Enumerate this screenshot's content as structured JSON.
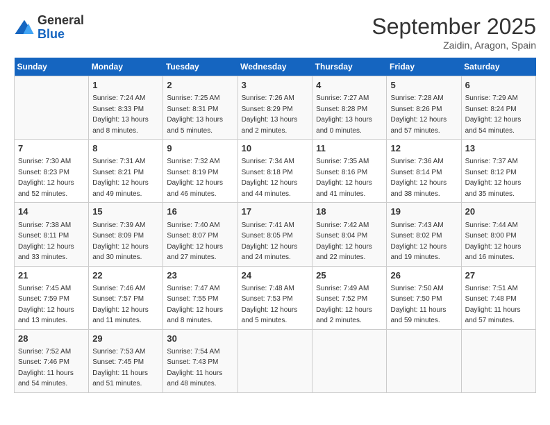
{
  "logo": {
    "general": "General",
    "blue": "Blue"
  },
  "header": {
    "month": "September 2025",
    "location": "Zaidin, Aragon, Spain"
  },
  "weekdays": [
    "Sunday",
    "Monday",
    "Tuesday",
    "Wednesday",
    "Thursday",
    "Friday",
    "Saturday"
  ],
  "weeks": [
    [
      {
        "day": null
      },
      {
        "day": 1,
        "sunrise": "7:24 AM",
        "sunset": "8:33 PM",
        "daylight": "13 hours and 8 minutes."
      },
      {
        "day": 2,
        "sunrise": "7:25 AM",
        "sunset": "8:31 PM",
        "daylight": "13 hours and 5 minutes."
      },
      {
        "day": 3,
        "sunrise": "7:26 AM",
        "sunset": "8:29 PM",
        "daylight": "13 hours and 2 minutes."
      },
      {
        "day": 4,
        "sunrise": "7:27 AM",
        "sunset": "8:28 PM",
        "daylight": "13 hours and 0 minutes."
      },
      {
        "day": 5,
        "sunrise": "7:28 AM",
        "sunset": "8:26 PM",
        "daylight": "12 hours and 57 minutes."
      },
      {
        "day": 6,
        "sunrise": "7:29 AM",
        "sunset": "8:24 PM",
        "daylight": "12 hours and 54 minutes."
      }
    ],
    [
      {
        "day": 7,
        "sunrise": "7:30 AM",
        "sunset": "8:23 PM",
        "daylight": "12 hours and 52 minutes."
      },
      {
        "day": 8,
        "sunrise": "7:31 AM",
        "sunset": "8:21 PM",
        "daylight": "12 hours and 49 minutes."
      },
      {
        "day": 9,
        "sunrise": "7:32 AM",
        "sunset": "8:19 PM",
        "daylight": "12 hours and 46 minutes."
      },
      {
        "day": 10,
        "sunrise": "7:34 AM",
        "sunset": "8:18 PM",
        "daylight": "12 hours and 44 minutes."
      },
      {
        "day": 11,
        "sunrise": "7:35 AM",
        "sunset": "8:16 PM",
        "daylight": "12 hours and 41 minutes."
      },
      {
        "day": 12,
        "sunrise": "7:36 AM",
        "sunset": "8:14 PM",
        "daylight": "12 hours and 38 minutes."
      },
      {
        "day": 13,
        "sunrise": "7:37 AM",
        "sunset": "8:12 PM",
        "daylight": "12 hours and 35 minutes."
      }
    ],
    [
      {
        "day": 14,
        "sunrise": "7:38 AM",
        "sunset": "8:11 PM",
        "daylight": "12 hours and 33 minutes."
      },
      {
        "day": 15,
        "sunrise": "7:39 AM",
        "sunset": "8:09 PM",
        "daylight": "12 hours and 30 minutes."
      },
      {
        "day": 16,
        "sunrise": "7:40 AM",
        "sunset": "8:07 PM",
        "daylight": "12 hours and 27 minutes."
      },
      {
        "day": 17,
        "sunrise": "7:41 AM",
        "sunset": "8:05 PM",
        "daylight": "12 hours and 24 minutes."
      },
      {
        "day": 18,
        "sunrise": "7:42 AM",
        "sunset": "8:04 PM",
        "daylight": "12 hours and 22 minutes."
      },
      {
        "day": 19,
        "sunrise": "7:43 AM",
        "sunset": "8:02 PM",
        "daylight": "12 hours and 19 minutes."
      },
      {
        "day": 20,
        "sunrise": "7:44 AM",
        "sunset": "8:00 PM",
        "daylight": "12 hours and 16 minutes."
      }
    ],
    [
      {
        "day": 21,
        "sunrise": "7:45 AM",
        "sunset": "7:59 PM",
        "daylight": "12 hours and 13 minutes."
      },
      {
        "day": 22,
        "sunrise": "7:46 AM",
        "sunset": "7:57 PM",
        "daylight": "12 hours and 11 minutes."
      },
      {
        "day": 23,
        "sunrise": "7:47 AM",
        "sunset": "7:55 PM",
        "daylight": "12 hours and 8 minutes."
      },
      {
        "day": 24,
        "sunrise": "7:48 AM",
        "sunset": "7:53 PM",
        "daylight": "12 hours and 5 minutes."
      },
      {
        "day": 25,
        "sunrise": "7:49 AM",
        "sunset": "7:52 PM",
        "daylight": "12 hours and 2 minutes."
      },
      {
        "day": 26,
        "sunrise": "7:50 AM",
        "sunset": "7:50 PM",
        "daylight": "11 hours and 59 minutes."
      },
      {
        "day": 27,
        "sunrise": "7:51 AM",
        "sunset": "7:48 PM",
        "daylight": "11 hours and 57 minutes."
      }
    ],
    [
      {
        "day": 28,
        "sunrise": "7:52 AM",
        "sunset": "7:46 PM",
        "daylight": "11 hours and 54 minutes."
      },
      {
        "day": 29,
        "sunrise": "7:53 AM",
        "sunset": "7:45 PM",
        "daylight": "11 hours and 51 minutes."
      },
      {
        "day": 30,
        "sunrise": "7:54 AM",
        "sunset": "7:43 PM",
        "daylight": "11 hours and 48 minutes."
      },
      {
        "day": null
      },
      {
        "day": null
      },
      {
        "day": null
      },
      {
        "day": null
      }
    ]
  ],
  "labels": {
    "sunrise": "Sunrise:",
    "sunset": "Sunset:",
    "daylight": "Daylight:"
  }
}
